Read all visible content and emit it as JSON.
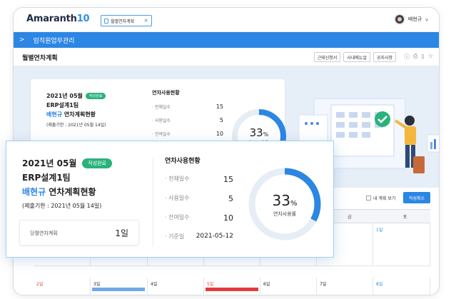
{
  "app": {
    "brand_text": "Amaranth",
    "brand_num": "10"
  },
  "tab": {
    "label": "월별연차계획",
    "close": "×"
  },
  "user": {
    "name": "배현규",
    "chevron": "∨"
  },
  "nav": {
    "arrow": ">",
    "title": "임직원업무관리"
  },
  "page": {
    "title": "월별연차계획",
    "buttons": [
      "근태신청서",
      "사내메뉴얼",
      "공지사항"
    ],
    "icons": [
      "help-icon",
      "print-icon",
      "delete-icon",
      "star-icon"
    ]
  },
  "summary": {
    "month": "2021년 05월",
    "status": "작성완료",
    "team": "ERP설계1팀",
    "name": "배현규",
    "plan_title": " 연차계획현황",
    "deadline": "(제출기한 : 2021년 05월 14일)",
    "monthly_label": "당월연차계획",
    "monthly_value": "1일",
    "usage_header": "연차사용현황",
    "rows": [
      {
        "label": "· 전체일수",
        "value": "15"
      },
      {
        "label": "· 사용일수",
        "value": "5"
      },
      {
        "label": "· 잔여일수",
        "value": "10"
      },
      {
        "label": "· 기준일",
        "value": "2021-05-12"
      }
    ],
    "percent": "33",
    "percent_sign": "%",
    "percent_value": 33,
    "percent_label": "연차사용률",
    "colors": {
      "accent": "#2b86e4",
      "ring_track": "#e6edf5",
      "badge": "#2ab27b"
    }
  },
  "calendar": {
    "toggle_label": "내 계획 보기",
    "cancel_label": "작성취소",
    "headers": [
      "금",
      "토"
    ],
    "row1": [
      {
        "day": "1일"
      }
    ],
    "row2": [
      "2일",
      "3일",
      "4일",
      "5일",
      "6일",
      "7일",
      "8일"
    ]
  }
}
